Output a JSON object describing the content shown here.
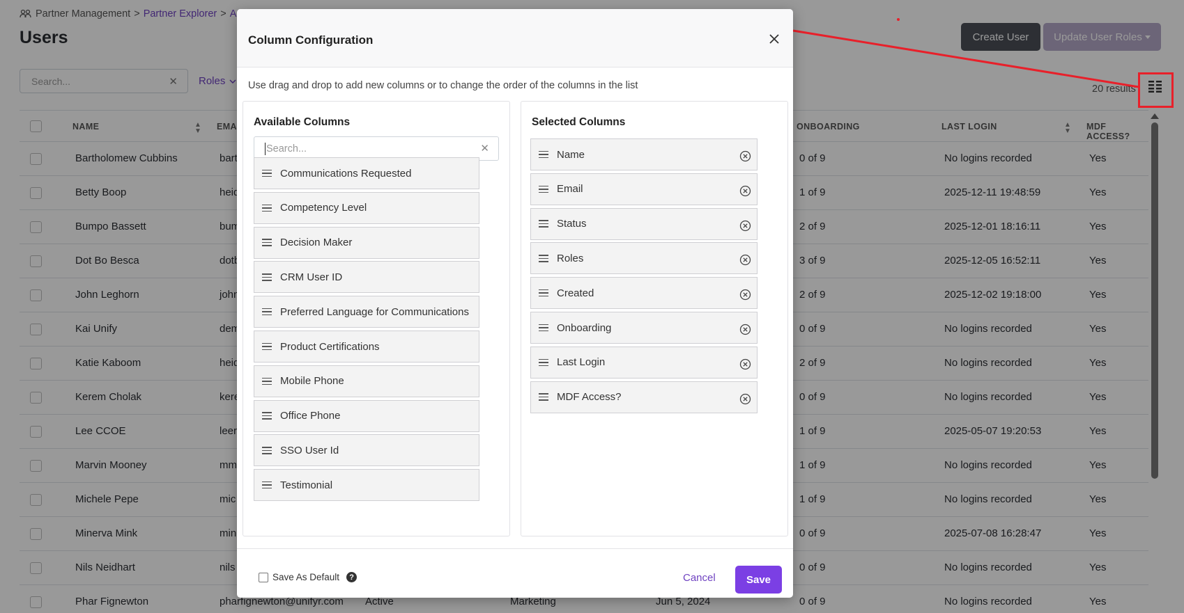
{
  "breadcrumb": {
    "root": "Partner Management",
    "sep1": ">",
    "link": "Partner Explorer",
    "sep2": ">",
    "current": "A"
  },
  "page": {
    "title": "Users",
    "results": "20 results",
    "search_placeholder": "Search...",
    "roles_filter": "Roles"
  },
  "header_buttons": {
    "create_user": "Create User",
    "update_roles": "Update User Roles"
  },
  "table": {
    "columns": {
      "name": "NAME",
      "email": "EMA",
      "onboarding": "ONBOARDING",
      "last_login": "LAST LOGIN",
      "mdf": "MDF ACCESS?"
    },
    "rows": [
      {
        "name": "Bartholomew Cubbins",
        "email": "bart",
        "status": "",
        "role": "",
        "created": "",
        "onboarding": "0 of 9",
        "last_login": "No logins recorded",
        "mdf": "Yes"
      },
      {
        "name": "Betty Boop",
        "email": "heid",
        "status": "",
        "role": "",
        "created": "",
        "onboarding": "1 of 9",
        "last_login": "2025-12-11 19:48:59",
        "mdf": "Yes"
      },
      {
        "name": "Bumpo Bassett",
        "email": "bum",
        "status": "",
        "role": "",
        "created": "",
        "onboarding": "2 of 9",
        "last_login": "2025-12-01 18:16:11",
        "mdf": "Yes"
      },
      {
        "name": "Dot Bo Besca",
        "email": "dotb",
        "status": "",
        "role": "",
        "created": "",
        "onboarding": "3 of 9",
        "last_login": "2025-12-05 16:52:11",
        "mdf": "Yes"
      },
      {
        "name": "John Leghorn",
        "email": "john",
        "status": "",
        "role": "",
        "created": "",
        "onboarding": "2 of 9",
        "last_login": "2025-12-02 19:18:00",
        "mdf": "Yes"
      },
      {
        "name": "Kai Unify",
        "email": "dem",
        "status": "",
        "role": "",
        "created": "",
        "onboarding": "0 of 9",
        "last_login": "No logins recorded",
        "mdf": "Yes"
      },
      {
        "name": "Katie Kaboom",
        "email": "heid",
        "status": "",
        "role": "",
        "created": "",
        "onboarding": "2 of 9",
        "last_login": "No logins recorded",
        "mdf": "Yes"
      },
      {
        "name": "Kerem Cholak",
        "email": "kere",
        "status": "",
        "role": "",
        "created": "",
        "onboarding": "0 of 9",
        "last_login": "No logins recorded",
        "mdf": "Yes"
      },
      {
        "name": "Lee CCOE",
        "email": "leer",
        "status": "",
        "role": "",
        "created": "",
        "onboarding": "1 of 9",
        "last_login": "2025-05-07 19:20:53",
        "mdf": "Yes"
      },
      {
        "name": "Marvin Mooney",
        "email": "mm",
        "status": "",
        "role": "",
        "created": "",
        "onboarding": "1 of 9",
        "last_login": "No logins recorded",
        "mdf": "Yes"
      },
      {
        "name": "Michele Pepe",
        "email": "mic",
        "status": "",
        "role": "",
        "created": "",
        "onboarding": "1 of 9",
        "last_login": "No logins recorded",
        "mdf": "Yes"
      },
      {
        "name": "Minerva Mink",
        "email": "min",
        "status": "",
        "role": "",
        "created": "",
        "onboarding": "0 of 9",
        "last_login": "2025-07-08 16:28:47",
        "mdf": "Yes"
      },
      {
        "name": "Nils Neidhart",
        "email": "nils",
        "status": "",
        "role": "",
        "created": "",
        "onboarding": "0 of 9",
        "last_login": "No logins recorded",
        "mdf": "Yes"
      },
      {
        "name": "Phar Fignewton",
        "email": "pharfignewton@unifyr.com",
        "status": "Active",
        "role": "Marketing",
        "created": "Jun 5, 2024",
        "onboarding": "0 of 9",
        "last_login": "No logins recorded",
        "mdf": "Yes"
      }
    ]
  },
  "modal": {
    "title": "Column Configuration",
    "intro": "Use drag and drop to add new columns or to change the order of the columns in the list",
    "available": {
      "title": "Available Columns",
      "search_placeholder": "Search...",
      "items": [
        "Communications Requested",
        "Competency Level",
        "Decision Maker",
        "CRM User ID",
        "Preferred Language for Communications",
        "Product Certifications",
        "Mobile Phone",
        "Office Phone",
        "SSO User Id",
        "Testimonial"
      ]
    },
    "selected": {
      "title": "Selected Columns",
      "items": [
        "Name",
        "Email",
        "Status",
        "Roles",
        "Created",
        "Onboarding",
        "Last Login",
        "MDF Access?"
      ]
    },
    "footer": {
      "save_default": "Save As Default",
      "help": "?",
      "cancel": "Cancel",
      "save": "Save"
    }
  },
  "colors": {
    "accent": "#7b3fe4",
    "link": "#6f42c1",
    "annotation": "#e8202a"
  }
}
